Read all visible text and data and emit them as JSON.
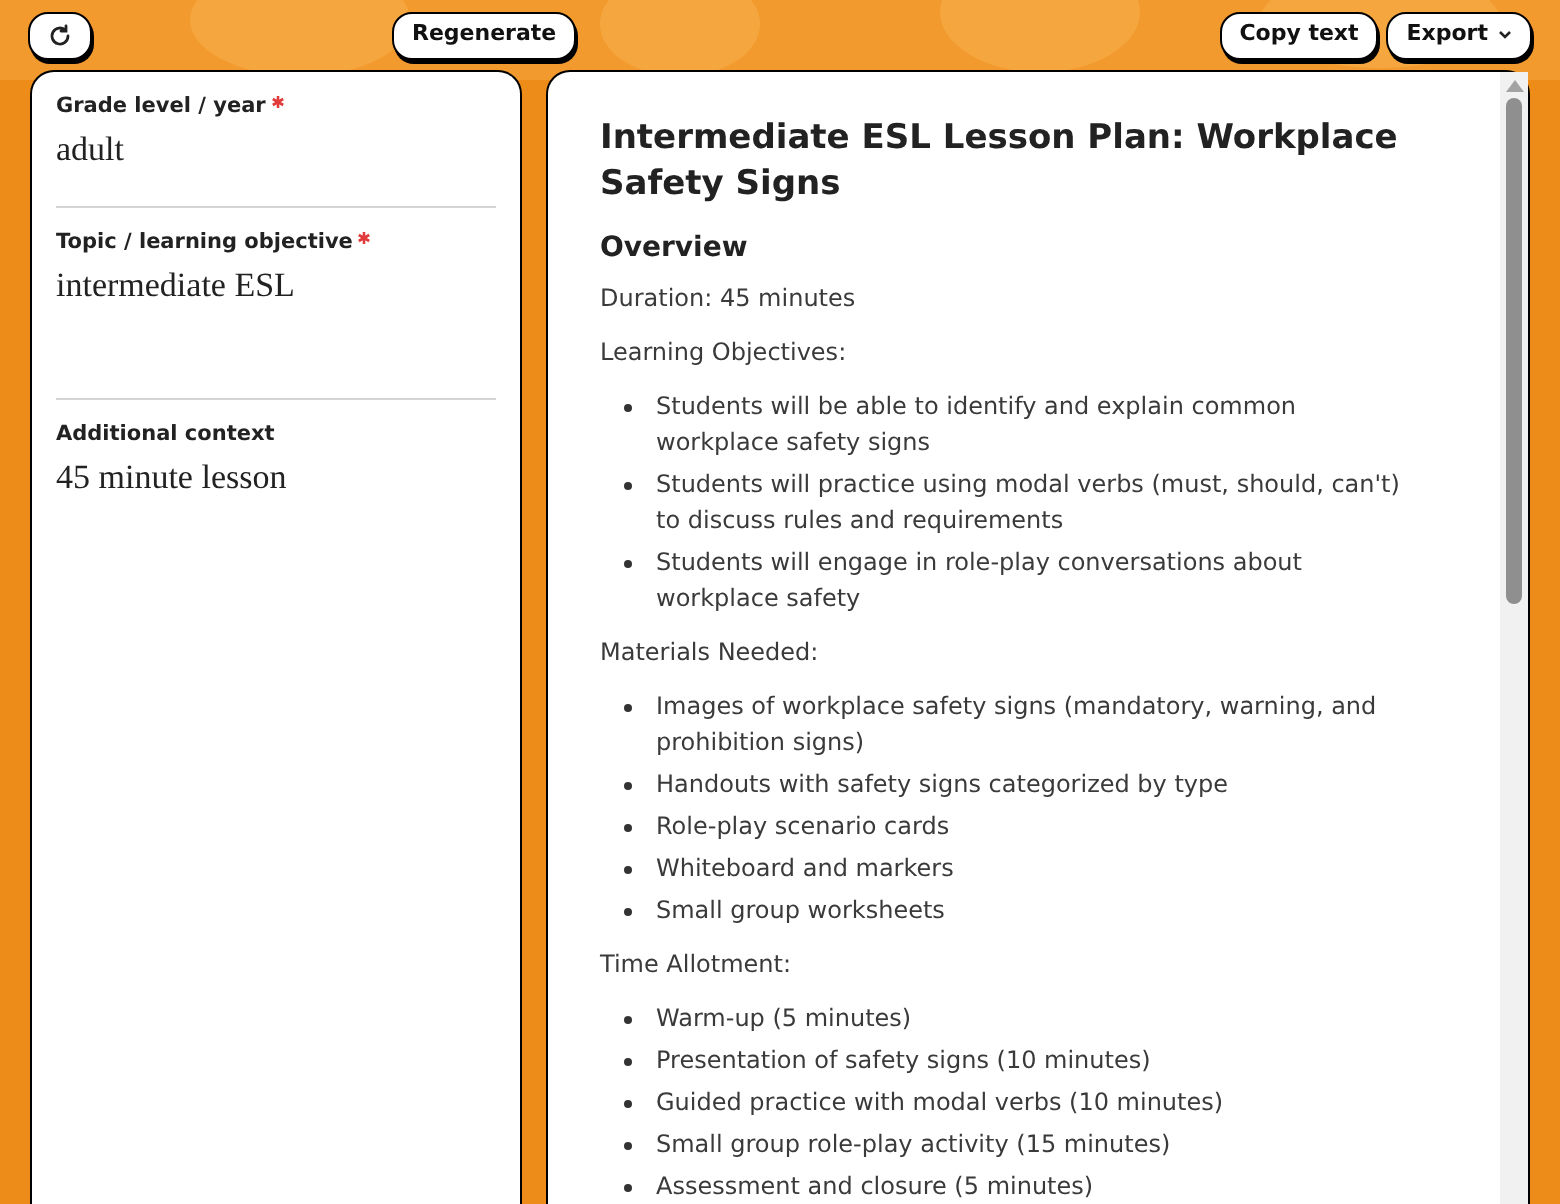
{
  "toolbar": {
    "regenerate": "Regenerate",
    "copy": "Copy text",
    "export": "Export"
  },
  "fields": [
    {
      "label": "Grade level / year",
      "required": true,
      "value": "adult",
      "kind": "input"
    },
    {
      "label": "Topic / learning objective",
      "required": true,
      "value": "intermediate ESL",
      "kind": "textarea"
    },
    {
      "label": "Additional context",
      "required": false,
      "value": "45 minute lesson",
      "kind": "input"
    }
  ],
  "document": [
    {
      "kind": "title",
      "text": "Intermediate ESL Lesson Plan: Workplace Safety Signs"
    },
    {
      "kind": "heading",
      "text": "Overview"
    },
    {
      "kind": "paragraph",
      "text": "Duration: 45 minutes"
    },
    {
      "kind": "paragraph",
      "text": "Learning Objectives:"
    },
    {
      "kind": "list",
      "items": [
        "Students will be able to identify and explain common workplace safety signs",
        "Students will practice using modal verbs (must, should, can't) to discuss rules and requirements",
        "Students will engage in role-play conversations about workplace safety"
      ]
    },
    {
      "kind": "paragraph",
      "text": "Materials Needed:"
    },
    {
      "kind": "list",
      "items": [
        "Images of workplace safety signs (mandatory, warning, and prohibition signs)",
        "Handouts with safety signs categorized by type",
        "Role-play scenario cards",
        "Whiteboard and markers",
        "Small group worksheets"
      ]
    },
    {
      "kind": "paragraph",
      "text": "Time Allotment:"
    },
    {
      "kind": "list",
      "items": [
        "Warm-up (5 minutes)",
        "Presentation of safety signs (10 minutes)",
        "Guided practice with modal verbs (10 minutes)",
        "Small group role-play activity (15 minutes)",
        "Assessment and closure (5 minutes)"
      ]
    }
  ]
}
